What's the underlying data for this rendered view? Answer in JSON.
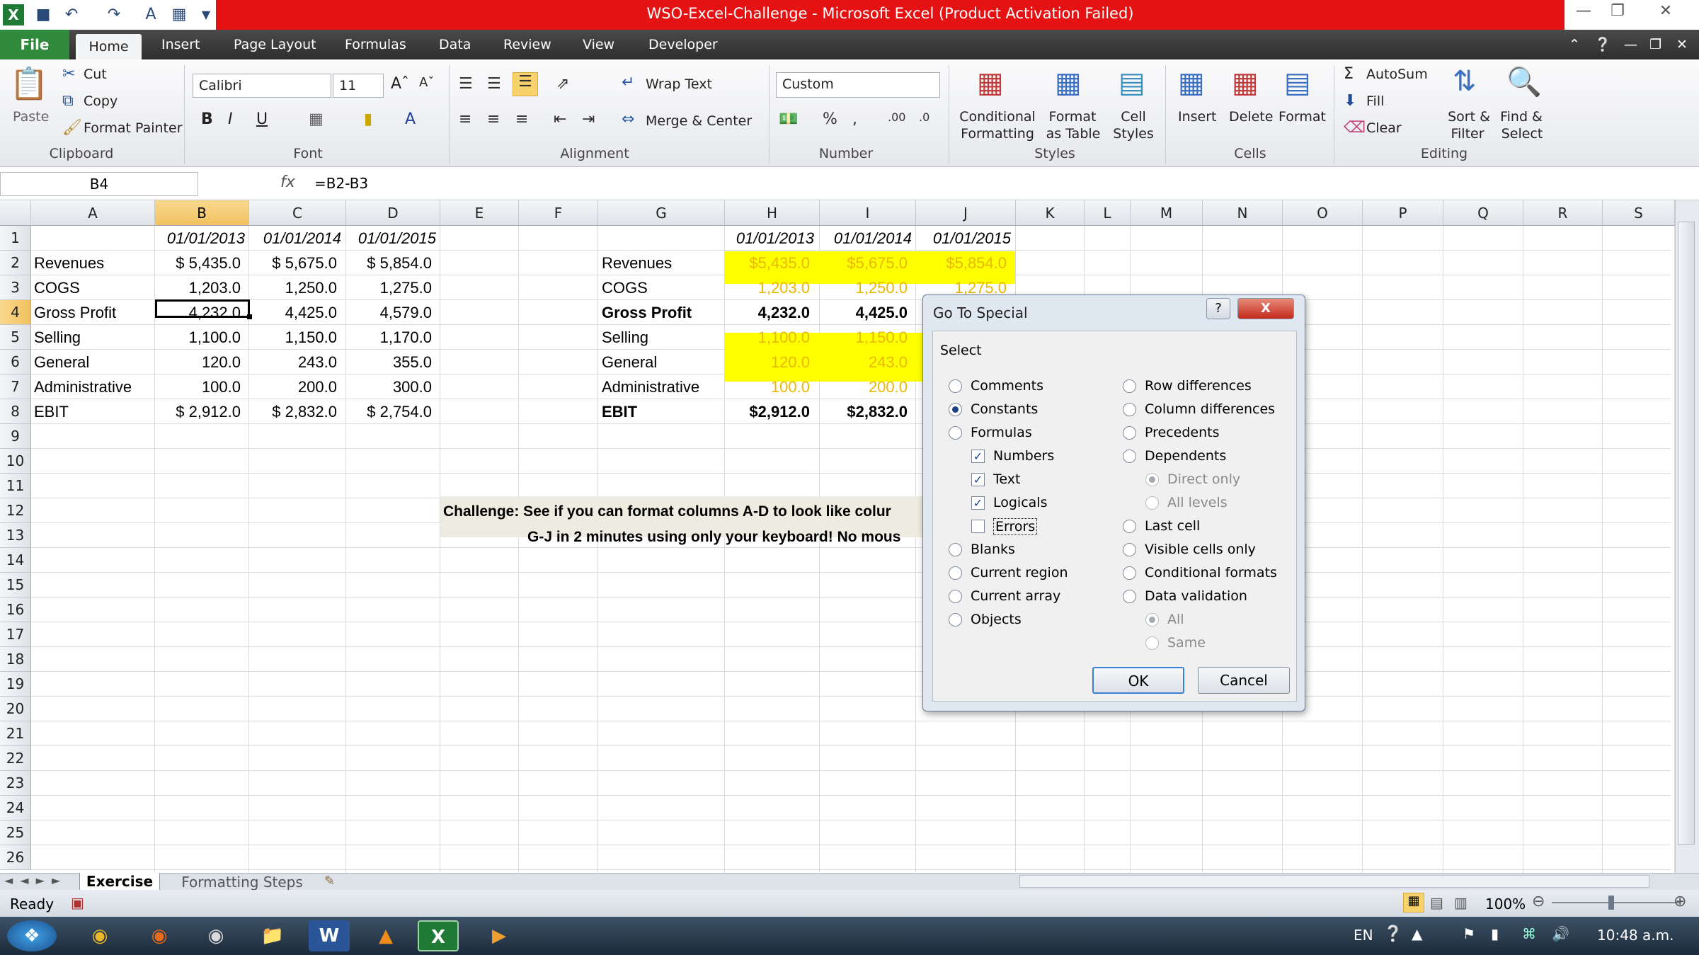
{
  "window": {
    "title": "WSO-Excel-Challenge  -  Microsoft Excel (Product Activation Failed)"
  },
  "tabs": {
    "file": "File",
    "home": "Home",
    "insert": "Insert",
    "page_layout": "Page Layout",
    "formulas": "Formulas",
    "data": "Data",
    "review": "Review",
    "view": "View",
    "developer": "Developer"
  },
  "ribbon": {
    "paste": "Paste",
    "cut": "Cut",
    "copy": "Copy",
    "format_painter": "Format Painter",
    "clipboard": "Clipboard",
    "font_name": "Calibri",
    "font_size": "11",
    "font": "Font",
    "wrap_text": "Wrap Text",
    "merge_center": "Merge & Center",
    "alignment": "Alignment",
    "number_format": "Custom",
    "number": "Number",
    "conditional_formatting": [
      "Conditional",
      "Formatting"
    ],
    "format_as_table": [
      "Format",
      "as Table"
    ],
    "cell_styles": [
      "Cell",
      "Styles"
    ],
    "styles": "Styles",
    "insert": "Insert",
    "delete": "Delete",
    "format": "Format",
    "cells": "Cells",
    "autosum": "AutoSum",
    "fill": "Fill",
    "clear": "Clear",
    "sort_filter": [
      "Sort &",
      "Filter"
    ],
    "find_select": [
      "Find &",
      "Select"
    ],
    "editing": "Editing"
  },
  "formula_bar": {
    "name_box": "B4",
    "fx": "fx",
    "formula": "=B2-B3"
  },
  "columns": [
    "A",
    "B",
    "C",
    "D",
    "E",
    "F",
    "G",
    "H",
    "I",
    "J",
    "K",
    "L",
    "M",
    "N",
    "O",
    "P",
    "Q",
    "R",
    "S"
  ],
  "rows": [
    "1",
    "2",
    "3",
    "4",
    "5",
    "6",
    "7",
    "8",
    "9",
    "10",
    "11",
    "12",
    "13",
    "14",
    "15",
    "16",
    "17",
    "18",
    "19",
    "20",
    "21",
    "22",
    "23",
    "24",
    "25",
    "26"
  ],
  "left_table": {
    "dates": [
      "01/01/2013",
      "01/01/2014",
      "01/01/2015"
    ],
    "labels": [
      "Revenues",
      "COGS",
      "Gross Profit",
      "Selling",
      "General",
      "Administrative",
      "EBIT"
    ],
    "values": [
      [
        "$  5,435.0",
        "$  5,675.0",
        "$  5,854.0"
      ],
      [
        "1,203.0",
        "1,250.0",
        "1,275.0"
      ],
      [
        "4,232.0",
        "4,425.0",
        "4,579.0"
      ],
      [
        "1,100.0",
        "1,150.0",
        "1,170.0"
      ],
      [
        "120.0",
        "243.0",
        "355.0"
      ],
      [
        "100.0",
        "200.0",
        "300.0"
      ],
      [
        "$  2,912.0",
        "$  2,832.0",
        "$  2,754.0"
      ]
    ]
  },
  "right_table": {
    "dates": [
      "01/01/2013",
      "01/01/2014",
      "01/01/2015"
    ],
    "labels": [
      "Revenues",
      "COGS",
      "Gross Profit",
      "Selling",
      "General",
      "Administrative",
      "EBIT"
    ],
    "values": [
      [
        "$5,435.0",
        "$5,675.0",
        "$5,854.0"
      ],
      [
        "1,203.0",
        "1,250.0",
        "1,275.0"
      ],
      [
        "4,232.0",
        "4,425.0",
        ""
      ],
      [
        "1,100.0",
        "1,150.0",
        ""
      ],
      [
        "120.0",
        "243.0",
        ""
      ],
      [
        "100.0",
        "200.0",
        ""
      ],
      [
        "$2,912.0",
        "$2,832.0",
        ""
      ]
    ]
  },
  "challenge": {
    "line1": "Challenge: See if you can format columns A-D to look like colur",
    "line2": "G-J in 2 minutes using only your keyboard! No mous"
  },
  "dialog": {
    "title": "Go To Special",
    "help": "?",
    "close": "X",
    "select": "Select",
    "left_options": [
      "Comments",
      "Constants",
      "Formulas",
      "Numbers",
      "Text",
      "Logicals",
      "Errors",
      "Blanks",
      "Current region",
      "Current array",
      "Objects"
    ],
    "right_options": [
      "Row differences",
      "Column differences",
      "Precedents",
      "Dependents",
      "Direct only",
      "All levels",
      "Last cell",
      "Visible cells only",
      "Conditional formats",
      "Data validation",
      "All",
      "Same"
    ],
    "selected": "Constants",
    "ok": "OK",
    "cancel": "Cancel"
  },
  "sheets": {
    "active": "Exercise",
    "other": "Formatting Steps"
  },
  "status": {
    "ready": "Ready",
    "zoom": "100%"
  },
  "taskbar": {
    "lang": "EN",
    "time": "10:48 a.m."
  },
  "colors": {
    "title_red": "#e41212",
    "file_green": "#2f8a3b",
    "highlight_yellow": "#ffff00",
    "selected_header": "#f1c15f"
  }
}
